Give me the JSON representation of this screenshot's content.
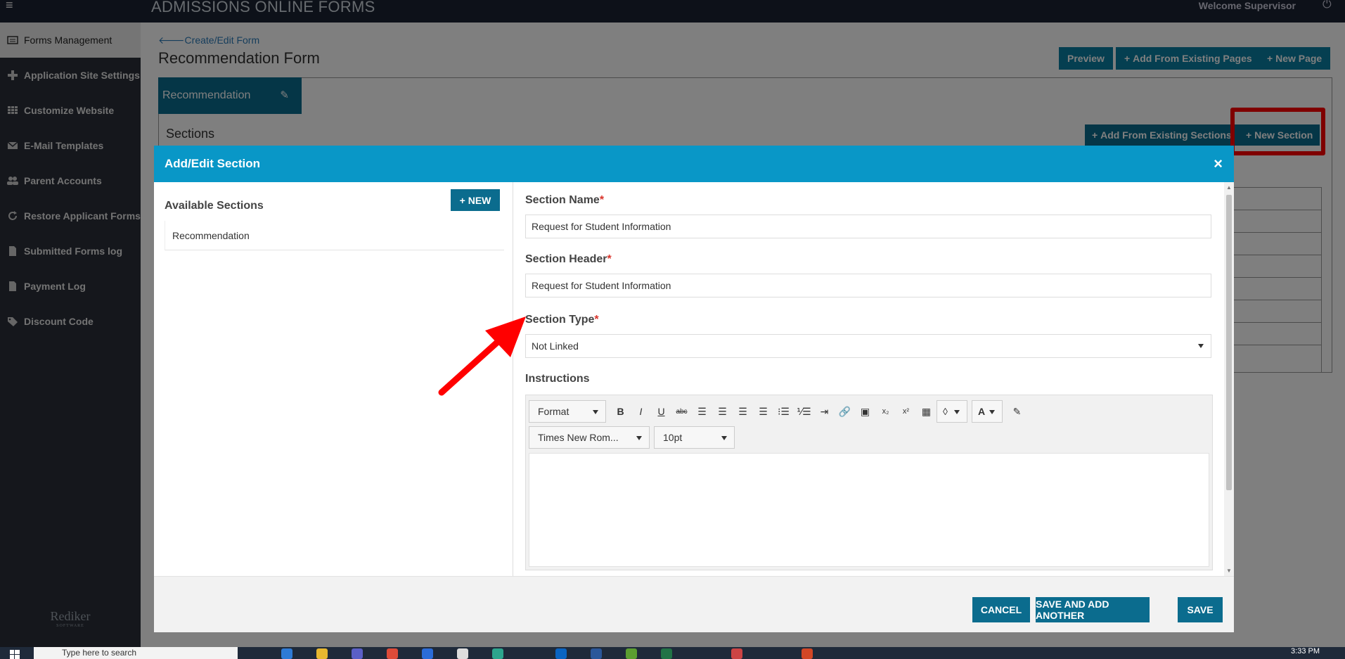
{
  "app": {
    "title": "ADMISSIONS ONLINE FORMS",
    "welcome": "Welcome Supervisor"
  },
  "sidebar": {
    "items": [
      {
        "label": "Forms Management",
        "icon": "list-icon"
      },
      {
        "label": "Application Site Settings",
        "icon": "plus-icon"
      },
      {
        "label": "Customize Website",
        "icon": "grid-icon"
      },
      {
        "label": "E-Mail Templates",
        "icon": "envelope-icon"
      },
      {
        "label": "Parent Accounts",
        "icon": "users-icon"
      },
      {
        "label": "Restore Applicant Forms",
        "icon": "refresh-icon"
      },
      {
        "label": "Submitted Forms log",
        "icon": "document-icon"
      },
      {
        "label": "Payment Log",
        "icon": "document-icon"
      },
      {
        "label": "Discount Code",
        "icon": "tag-icon"
      }
    ],
    "logo": "Rediker",
    "logo_sub": "SOFTWARE"
  },
  "page": {
    "back_link": "Create/Edit Form",
    "title": "Recommendation Form",
    "preview_label": "Preview",
    "add_existing_pages_label": "Add From Existing Pages",
    "new_page_label": "New Page",
    "tab_label": "Recommendation",
    "sections_label": "Sections",
    "add_existing_sections_label": "Add From Existing Sections",
    "new_section_label": "New Section"
  },
  "modal": {
    "title": "Add/Edit Section",
    "close": "×",
    "available_sections_title": "Available Sections",
    "new_label": "NEW",
    "available_sections": [
      "Recommendation"
    ],
    "section_name_label": "Section Name",
    "section_name_value": "Request for Student Information",
    "section_header_label": "Section Header",
    "section_header_value": "Request for Student Information",
    "section_type_label": "Section Type",
    "section_type_value": "Not Linked",
    "instructions_label": "Instructions",
    "required_mark": "*",
    "editor": {
      "format_label": "Format",
      "font_family": "Times New Rom...",
      "font_size": "10pt"
    },
    "cancel_label": "CANCEL",
    "save_add_label": "SAVE AND ADD ANOTHER",
    "save_label": "SAVE"
  },
  "taskbar": {
    "search_placeholder": "Type here to search",
    "time": "3:33 PM"
  },
  "colors": {
    "accent": "#0b6c8e",
    "header": "#0997c7",
    "annotation": "#ff0000"
  }
}
